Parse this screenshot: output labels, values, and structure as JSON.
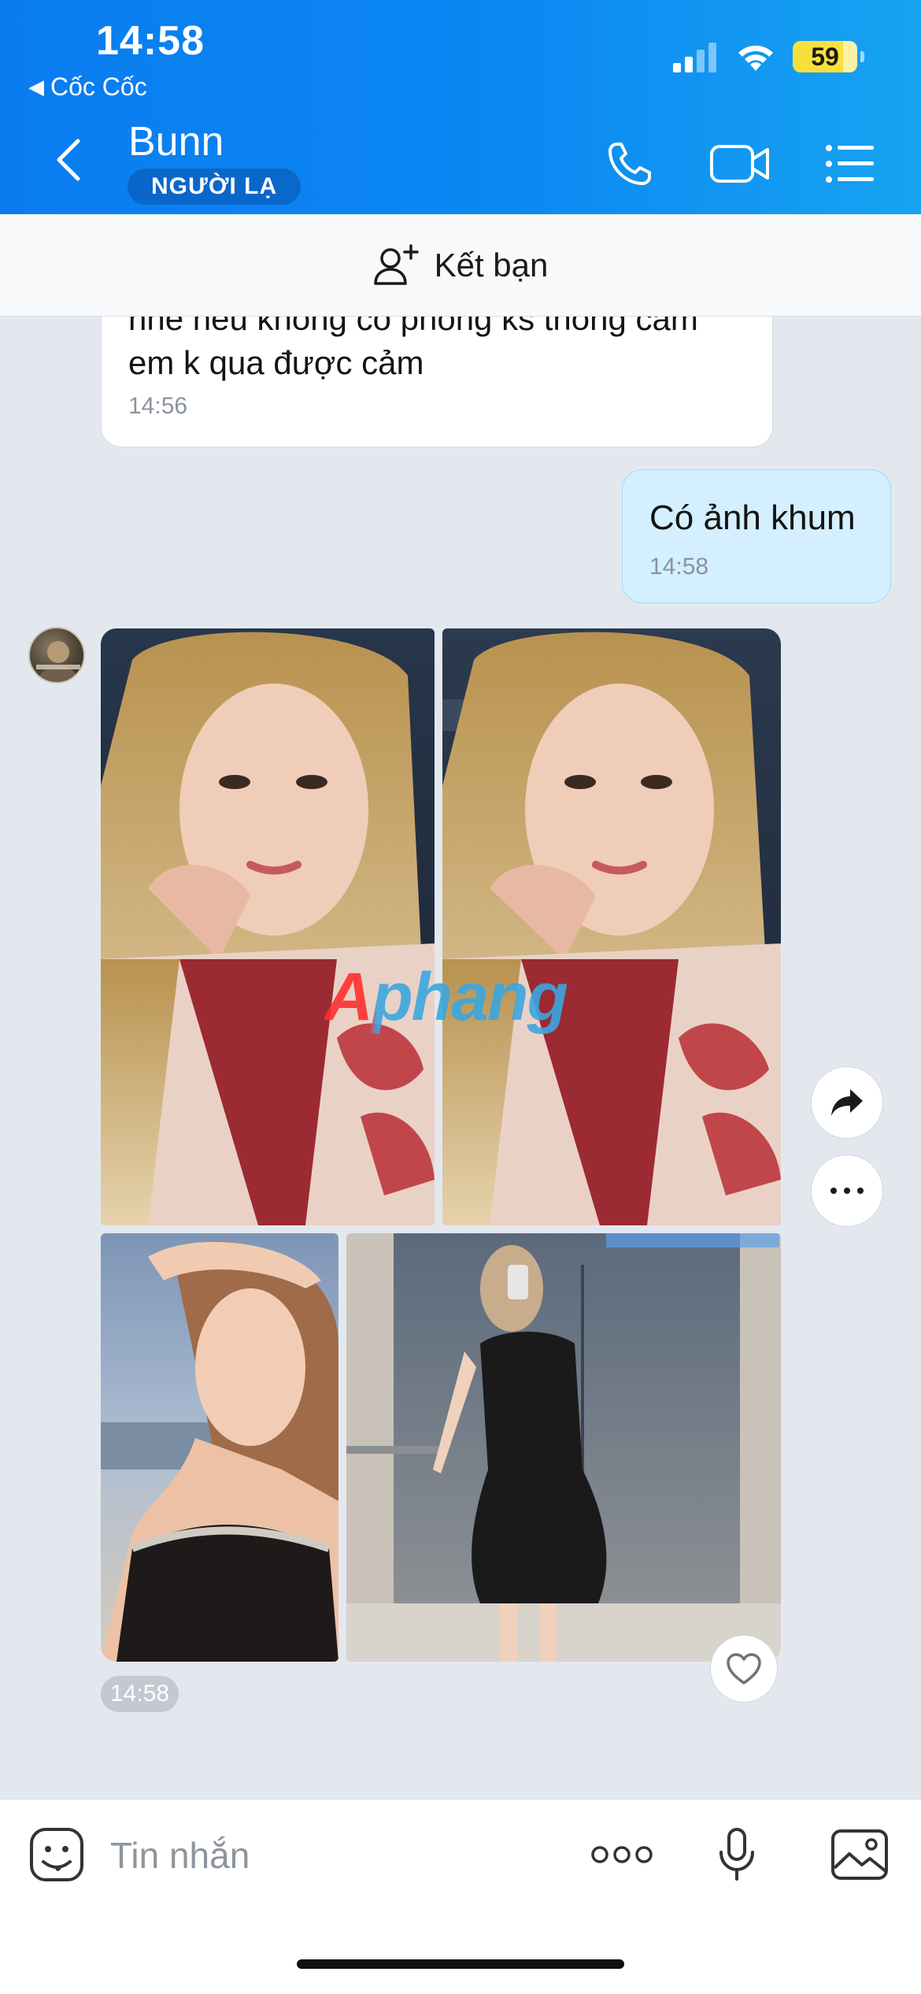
{
  "status_bar": {
    "time": "14:58",
    "back_app": "Cốc Cốc",
    "battery": "59",
    "icons": [
      "signal-icon",
      "wifi-icon",
      "battery-icon"
    ]
  },
  "header": {
    "contact_name": "Bunn",
    "badge": "NGƯỜI LẠ",
    "icons": [
      "back-icon",
      "phone-icon",
      "video-call-icon",
      "menu-list-icon"
    ]
  },
  "add_friend": {
    "label": "Kết bạn"
  },
  "messages": [
    {
      "direction": "incoming",
      "text": "nhé nếu không có phòng ks thông cảm em k qua được cảm",
      "time": "14:56"
    },
    {
      "direction": "outgoing",
      "text": "Có ảnh khum",
      "time": "14:58"
    }
  ],
  "photo_group": {
    "time": "14:58",
    "watermark": "Aphang",
    "count": 4
  },
  "input_bar": {
    "placeholder": "Tin nhắn",
    "icons": [
      "sticker-icon",
      "more-options-icon",
      "microphone-icon",
      "image-icon"
    ]
  },
  "colors": {
    "header_start": "#0a7cf0",
    "header_end": "#17a3f2",
    "outgoing_bubble": "#d4efff",
    "chat_bg": "#e3e8ef"
  }
}
